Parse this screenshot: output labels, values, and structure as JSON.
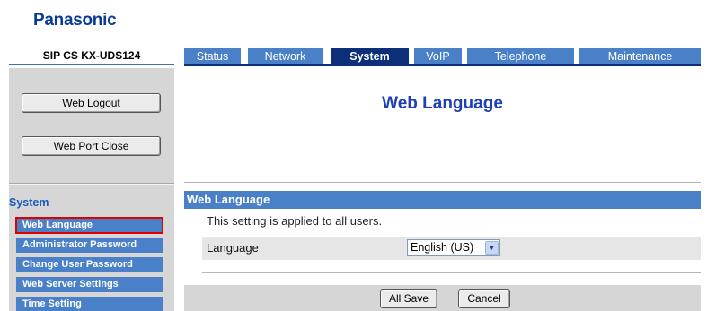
{
  "brand": {
    "logo": "Panasonic"
  },
  "header": {
    "model": "SIP CS KX-UDS124"
  },
  "tabs": [
    {
      "label": "Status"
    },
    {
      "label": "Network"
    },
    {
      "label": "System",
      "active": true
    },
    {
      "label": "VoIP"
    },
    {
      "label": "Telephone"
    },
    {
      "label": "Maintenance"
    }
  ],
  "sidebar": {
    "logout_label": "Web Logout",
    "port_close_label": "Web Port Close",
    "section_title": "System",
    "items": [
      {
        "label": "Web Language",
        "selected": true
      },
      {
        "label": "Administrator Password"
      },
      {
        "label": "Change User Password"
      },
      {
        "label": "Web Server Settings"
      },
      {
        "label": "Time Setting"
      }
    ]
  },
  "main": {
    "page_title": "Web Language",
    "section_title": "Web Language",
    "note": "This setting is applied to all users.",
    "language_label": "Language",
    "language_value": "English (US)"
  },
  "footer": {
    "all_save_label": "All Save",
    "cancel_label": "Cancel"
  },
  "colors": {
    "tab": "#4a80c8",
    "tab_active": "#0d2f7a",
    "title": "#1e3fb5",
    "selection_outline": "#e00000"
  }
}
